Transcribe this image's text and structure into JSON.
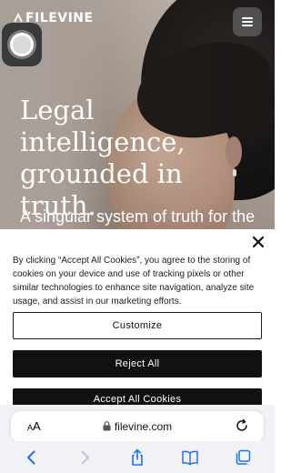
{
  "brand": {
    "logo_text": "FILEVINE"
  },
  "hero": {
    "headline_line1": "Legal intelligence,",
    "headline_line2": "grounded in",
    "headline_line3": "truth.",
    "subheadline": "A singular system of truth for the"
  },
  "cookie_banner": {
    "text": "By clicking “Accept All Cookies”, you agree to the storing of cookies on your device and use of tracking pixels or other similar technologies to enhance site navigation, analyze site usage, and assist in our marketing efforts.",
    "customize_label": "Customize",
    "reject_label": "Reject All",
    "accept_label": "Accept All Cookies"
  },
  "browser": {
    "text_size_small": "A",
    "text_size_large": "A",
    "url": "filevine.com"
  },
  "colors": {
    "button_dark": "#111111",
    "safari_bar": "#f2f2f6",
    "toolbar_icon": "#1a73e8"
  },
  "icons": {
    "menu": "hamburger-icon",
    "close": "close-icon",
    "lock": "lock-icon",
    "reload": "reload-icon",
    "back": "chevron-left-icon",
    "forward": "chevron-right-icon",
    "share": "share-icon",
    "bookmarks": "book-icon",
    "tabs": "tabs-icon"
  }
}
